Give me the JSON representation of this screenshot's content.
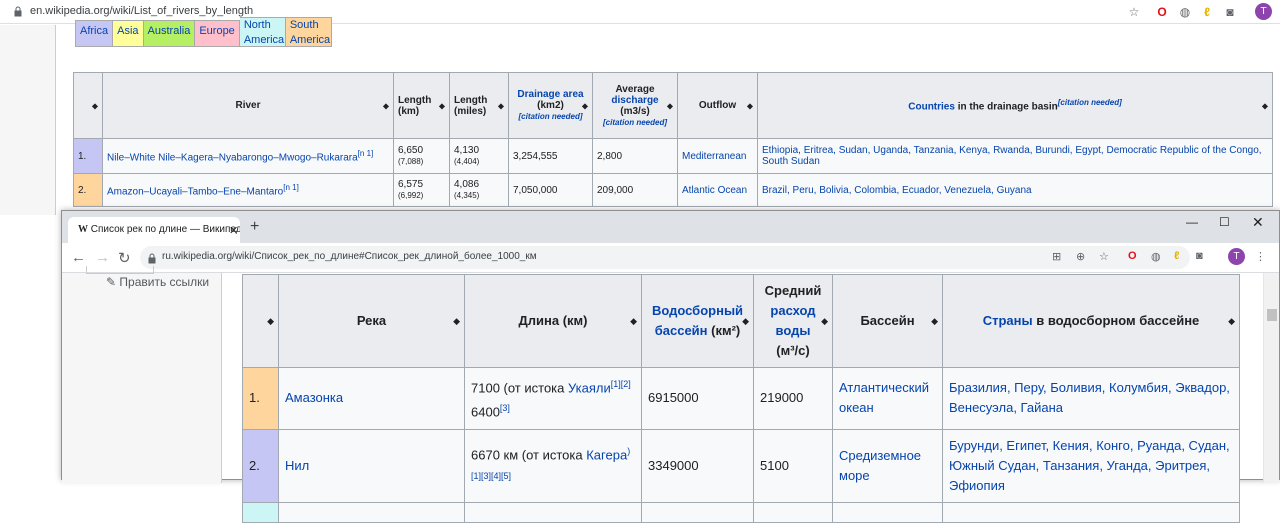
{
  "bg_browser": {
    "url": "en.wikipedia.org/wiki/List_of_rivers_by_length",
    "avatar": "T"
  },
  "legend": [
    {
      "label": "Africa",
      "color": "#c6c6f5"
    },
    {
      "label": "Asia",
      "color": "#ffff99"
    },
    {
      "label": "Australia",
      "color": "#b5ef63"
    },
    {
      "label": "Europe",
      "color": "#ffc0cb"
    },
    {
      "label": "North America",
      "color": "#ccf5f5"
    },
    {
      "label": "South America",
      "color": "#ffd59e"
    }
  ],
  "en_table": {
    "headers": {
      "river": "River",
      "length_km": "Length (km)",
      "length_mi": "Length (miles)",
      "drainage_link": "Drainage area",
      "drainage_unit": "(km2)",
      "drainage_cite": "[citation needed]",
      "discharge_prefix": "Average",
      "discharge_link": "discharge",
      "discharge_unit": "(m3/s)",
      "discharge_cite": "[citation needed]",
      "outflow": "Outflow",
      "countries_link": "Countries",
      "countries_rest": " in the drainage basin",
      "countries_cite": "[citation needed]"
    },
    "rows": [
      {
        "rank": "1.",
        "river": "Nile–White Nile–Kagera–Nyabarongo–Mwogo–Rukarara",
        "note": "[n 1]",
        "km": "6,650",
        "km_alt": "(7,088)",
        "mi": "4,130",
        "mi_alt": "(4,404)",
        "area": "3,254,555",
        "discharge": "2,800",
        "outflow": "Mediterranean",
        "countries": "Ethiopia, Eritrea, Sudan, Uganda, Tanzania, Kenya, Rwanda, Burundi, Egypt, Democratic Republic of the Congo, South Sudan",
        "color": "#c6c6f5"
      },
      {
        "rank": "2.",
        "river": "Amazon–Ucayali–Tambo–Ene–Mantaro",
        "note": "[n 1]",
        "km": "6,575",
        "km_alt": "(6,992)",
        "mi": "4,086",
        "mi_alt": "(4,345)",
        "area": "7,050,000",
        "discharge": "209,000",
        "outflow": "Atlantic Ocean",
        "countries": "Brazil, Peru, Bolivia, Colombia, Ecuador, Venezuela, Guyana",
        "color": "#ffd59e"
      }
    ]
  },
  "fg_browser": {
    "tab_title": "Список рек по длине — Википедия",
    "url": "ru.wikipedia.org/wiki/Список_рек_по_длине#Список_рек_длиной_более_1000_км",
    "avatar": "T",
    "edit_links": "Править ссылки"
  },
  "ru_table": {
    "headers": {
      "river": "Река",
      "length": "Длина (км)",
      "basin_link": "Водосборный бассейн",
      "basin_unit": " (км²)",
      "discharge_prefix": "Средний",
      "discharge_link": "расход воды",
      "discharge_unit": "(м³/с)",
      "outflow": "Бассейн",
      "countries_link": "Страны",
      "countries_rest": " в водосборном бассейне"
    },
    "rows": [
      {
        "rank": "1.",
        "river": "Амазонка",
        "len_a": "7100 (от истока ",
        "len_link": "Укаяли",
        "len_ref1": "[1][2]",
        "len_b": "6400",
        "len_ref2": "[3]",
        "area": "6915000",
        "discharge": "219000",
        "outflow": "Атлантический океан",
        "countries": "Бразилия, Перу, Боливия, Колумбия, Эквадор, Венесуэла, Гайана",
        "color": "#ffd59e"
      },
      {
        "rank": "2.",
        "river": "Нил",
        "len_a": "6670 км (от истока ",
        "len_link": "Кагера",
        "len_ref1": ")[1][3][4][5]",
        "len_b": "",
        "len_ref2": "",
        "area": "3349000",
        "discharge": "5100",
        "outflow": "Средиземное море",
        "countries": "Бурунди, Египет, Кения, Конго, Руанда, Судан, Южный Судан, Танзания, Уганда, Эритрея, Эфиопия",
        "color": "#c6c6f5"
      }
    ]
  }
}
